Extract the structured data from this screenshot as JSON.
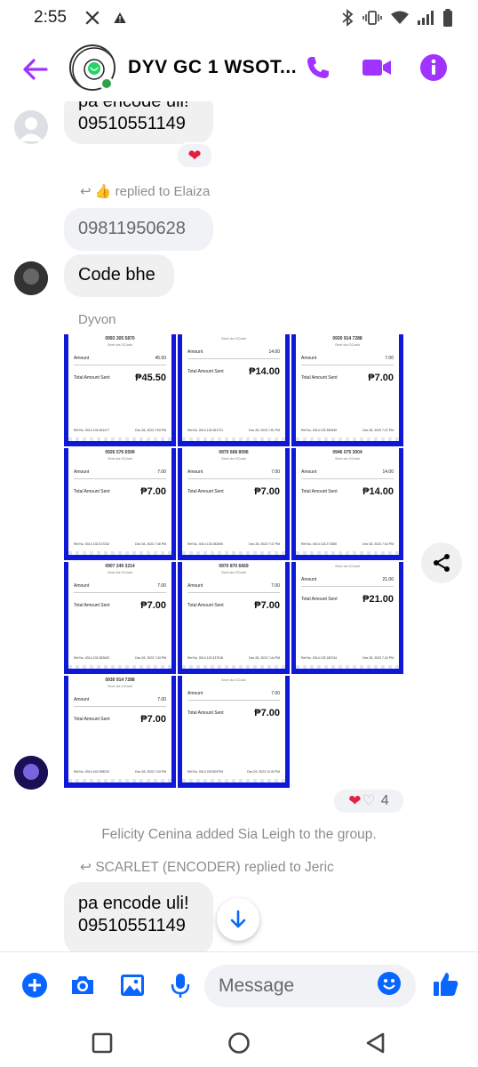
{
  "status_bar": {
    "time": "2:55"
  },
  "header": {
    "title": "DYV GC 1 WSOT...",
    "avatar_text_top": "DYV WSOT",
    "avatar_text_bottom": "ZUBAHB"
  },
  "colors": {
    "accent": "#a033ff",
    "blue": "#0866ff",
    "receipt_border": "#1018d8"
  },
  "messages": {
    "m1_text_line1": "pa encode uli!",
    "m1_text_line2": "09510551149",
    "reply1": "replied to Elaiza",
    "m2_text": "09811950628",
    "m3_text": "Code bhe",
    "sender_dyvon": "Dyvon",
    "reaction_count": "4",
    "system_msg": "Felicity Cenina added Sia Leigh to the group.",
    "reply2": "SCARLET (ENCODER) replied to Jeric",
    "m4_text_line1": "pa encode uli!",
    "m4_text_line2": "09510551149"
  },
  "receipts": [
    {
      "num": "0993 305 5870",
      "amount": "45.50",
      "total": "₱45.50",
      "date": "Dec 28, 2023 7:53 PM",
      "ref": "0014 133 451477"
    },
    {
      "num": "",
      "amount": "14.00",
      "total": "₱14.00",
      "date": "Dec 28, 2023 7:51 PM",
      "ref": "0014 133 351721"
    },
    {
      "num": "0930 914 7288",
      "amount": "7.00",
      "total": "₱7.00",
      "date": "Dec 28, 2023 7:47 PM",
      "ref": "0014 133 355439"
    },
    {
      "num": "0926 576 6599",
      "amount": "7.00",
      "total": "₱7.00",
      "date": "Dec 28, 2023 7:48 PM",
      "ref": "0014 133 317232"
    },
    {
      "num": "0970 668 8096",
      "amount": "7.00",
      "total": "₱7.00",
      "date": "Dec 28, 2023 7:47 PM",
      "ref": "0014 133 282590"
    },
    {
      "num": "0946 075 3004",
      "amount": "14.00",
      "total": "₱14.00",
      "date": "Dec 28, 2023 7:42 PM",
      "ref": "0014 133 271580"
    },
    {
      "num": "0907 249 3214",
      "amount": "7.00",
      "total": "₱7.00",
      "date": "Dec 28, 2023 7:43 PM",
      "ref": "0014 133 282620"
    },
    {
      "num": "0970 870 6669",
      "amount": "7.00",
      "total": "₱7.00",
      "date": "Dec 28, 2023 7:44 PM",
      "ref": "0014 133 337918"
    },
    {
      "num": "",
      "amount": "21.00",
      "total": "₱21.00",
      "date": "Dec 28, 2023 7:42 PM",
      "ref": "0014 133 183744"
    },
    {
      "num": "0930 914 7288",
      "amount": "7.00",
      "total": "₱7.00",
      "date": "Dec 28, 2023 7:43 PM",
      "ref": "0014 143 398220"
    },
    {
      "num": "",
      "amount": "7.00",
      "total": "₱7.00",
      "date": "Dec 29, 2023 12:40 PM",
      "ref": "0014 203 809793"
    }
  ],
  "receipt_labels": {
    "sent_via": "Sent via GCash",
    "amount": "Amount",
    "total": "Total Amount Sent",
    "ref": "Ref No."
  },
  "composer": {
    "placeholder": "Message"
  }
}
